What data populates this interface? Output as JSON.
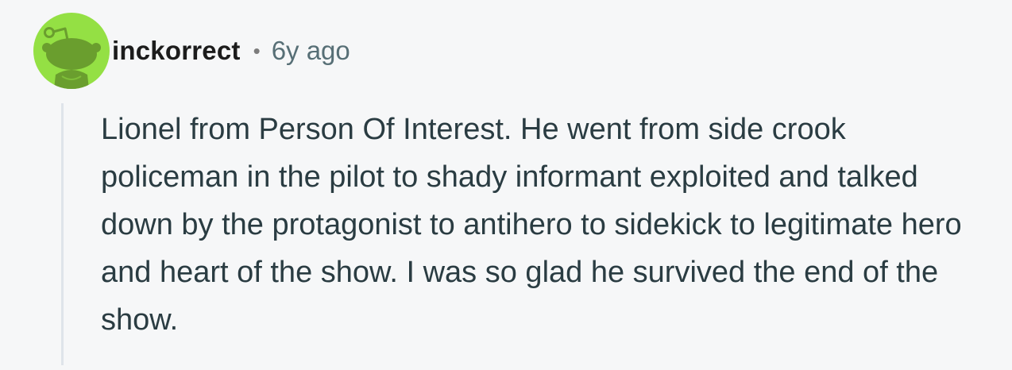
{
  "comment": {
    "username": "inckorrect",
    "separator": "•",
    "time": "6y ago",
    "body": "Lionel from Person Of Interest. He went from side crook policeman in the pilot to shady informant exploited and talked down by the protagonist to antihero to sidekick to legitimate hero and heart of the show. I was so glad he survived the end of the show.",
    "avatar": {
      "icon": "snoo-avatar-icon",
      "background_color": "#94e044",
      "figure_color": "#6a9e2e"
    }
  },
  "colors": {
    "background": "#f6f7f8",
    "username": "#1c1c1c",
    "meta": "#576f76",
    "body": "#2a3c42",
    "thread_line": "#dfe4ea"
  }
}
